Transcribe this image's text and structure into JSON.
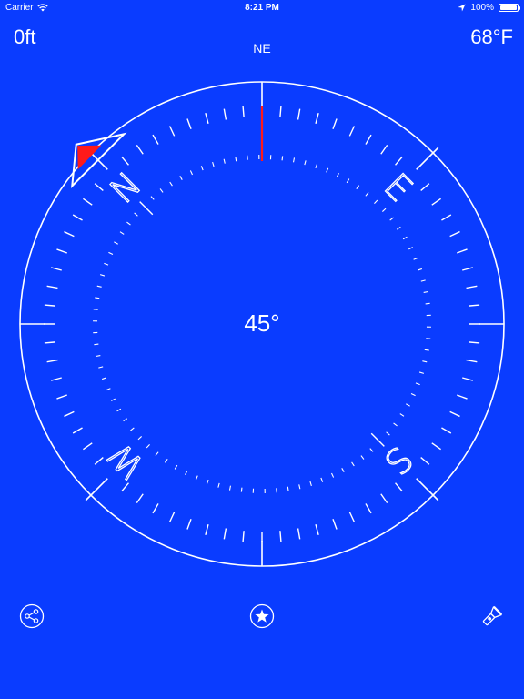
{
  "status_bar": {
    "carrier": "Carrier",
    "time": "8:21 PM",
    "battery_percent": "100%",
    "battery_level": 1.0
  },
  "readouts": {
    "altitude": "0ft",
    "temperature": "68°F",
    "direction": "NE",
    "heading": "45°"
  },
  "compass": {
    "cardinals": [
      "N",
      "E",
      "S",
      "W"
    ],
    "heading_degrees": 45
  },
  "toolbar": {
    "share_icon": "share-icon",
    "favorite_icon": "star-icon",
    "flashlight_icon": "flashlight-icon"
  },
  "colors": {
    "background": "#0a3cff",
    "foreground": "#ffffff",
    "needle": "#ff1a1a"
  }
}
